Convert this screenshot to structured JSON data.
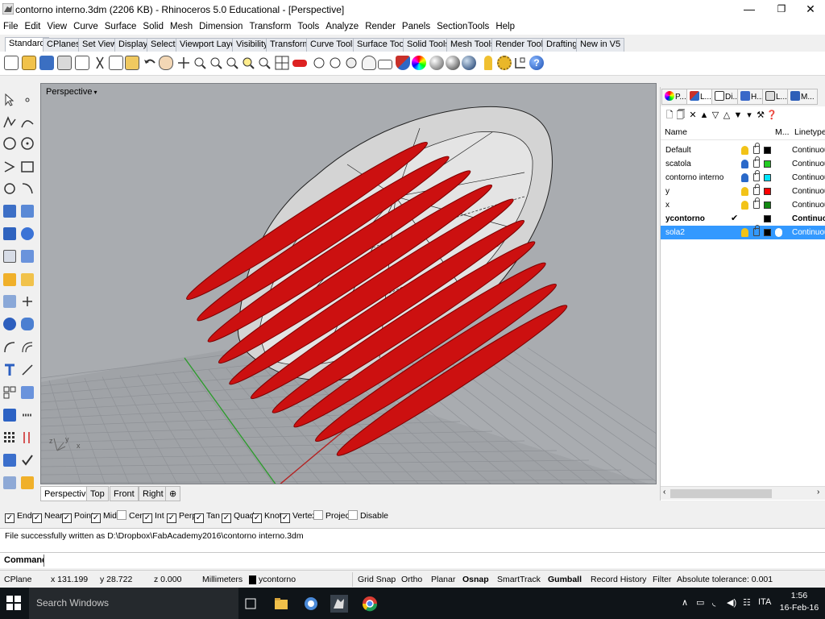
{
  "window": {
    "title": "contorno interno.3dm (2206 KB) - Rhinoceros 5.0 Educational - [Perspective]",
    "minimize": "—",
    "maximize": "❐",
    "close": "✕"
  },
  "menu": [
    "File",
    "Edit",
    "View",
    "Curve",
    "Surface",
    "Solid",
    "Mesh",
    "Dimension",
    "Transform",
    "Tools",
    "Analyze",
    "Render",
    "Panels",
    "SectionTools",
    "Help"
  ],
  "toolbar_tabs": [
    "Standard",
    "CPlanes",
    "Set View",
    "Display",
    "Select",
    "Viewport Layout",
    "Visibility",
    "Transform",
    "Curve Tools",
    "Surface Tools",
    "Solid Tools",
    "Mesh Tools",
    "Render Tools",
    "Drafting",
    "New in V5"
  ],
  "viewport": {
    "label": "Perspective",
    "dropdown": "▾",
    "tabs": [
      "Perspective",
      "Top",
      "Front",
      "Right"
    ],
    "add_tab": "⊕",
    "axis_labels": {
      "z": "z",
      "y": "y",
      "x": "x"
    }
  },
  "panel": {
    "tabs": [
      "P...",
      "L...",
      "Di...",
      "H...",
      "L...",
      "M..."
    ],
    "columns": {
      "name": "Name",
      "material": "M...",
      "linetype": "Linetype"
    },
    "layers": [
      {
        "name": "Default",
        "color": "#000000",
        "bulb": "#f2c318",
        "linetype": "Continuous",
        "state": "normal"
      },
      {
        "name": "scatola",
        "color": "#22cc22",
        "bulb": "#2a69c9",
        "linetype": "Continuous",
        "state": "normal"
      },
      {
        "name": "contorno interno",
        "color": "#00e5ff",
        "bulb": "#2a69c9",
        "linetype": "Continuous",
        "state": "normal"
      },
      {
        "name": "y",
        "color": "#ff0000",
        "bulb": "#f2c318",
        "linetype": "Continuous",
        "state": "normal"
      },
      {
        "name": "x",
        "color": "#118811",
        "bulb": "#f2c318",
        "linetype": "Continuous",
        "state": "normal"
      },
      {
        "name": "ycontorno",
        "color": "#000000",
        "bulb": "",
        "linetype": "Continuous",
        "state": "current",
        "check": "✔"
      },
      {
        "name": "sola2",
        "color": "#000000",
        "bulb": "#f2c318",
        "linetype": "Continuous",
        "state": "selected"
      }
    ]
  },
  "osnap": [
    {
      "label": "End",
      "checked": true
    },
    {
      "label": "Near",
      "checked": true
    },
    {
      "label": "Point",
      "checked": true
    },
    {
      "label": "Mid",
      "checked": true
    },
    {
      "label": "Cen",
      "checked": false
    },
    {
      "label": "Int",
      "checked": true
    },
    {
      "label": "Perp",
      "checked": true
    },
    {
      "label": "Tan",
      "checked": true
    },
    {
      "label": "Quad",
      "checked": true
    },
    {
      "label": "Knot",
      "checked": true
    },
    {
      "label": "Vertex",
      "checked": true
    },
    {
      "label": "Project",
      "checked": false
    },
    {
      "label": "Disable",
      "checked": false
    }
  ],
  "command": {
    "history": "File successfully written as D:\\Dropbox\\FabAcademy2016\\contorno interno.3dm",
    "prompt": "Command:",
    "value": ""
  },
  "status": {
    "cplane": "CPlane",
    "x": "x 131.199",
    "y": "y 28.722",
    "z": "z 0.000",
    "units": "Millimeters",
    "layer": "ycontorno",
    "layer_color": "#000000",
    "grid_snap": "Grid Snap",
    "ortho": "Ortho",
    "planar": "Planar",
    "osnap": "Osnap",
    "smarttrack": "SmartTrack",
    "gumball": "Gumball",
    "record_history": "Record History",
    "filter": "Filter",
    "tolerance": "Absolute tolerance: 0.001"
  },
  "taskbar": {
    "search": "Search Windows",
    "lang": "ITA",
    "time": "1:56",
    "date": "16-Feb-16"
  },
  "colors": {
    "accent_red": "#cc1010",
    "selection_blue": "#3399ff",
    "viewport_bg": "#a9acb0"
  }
}
